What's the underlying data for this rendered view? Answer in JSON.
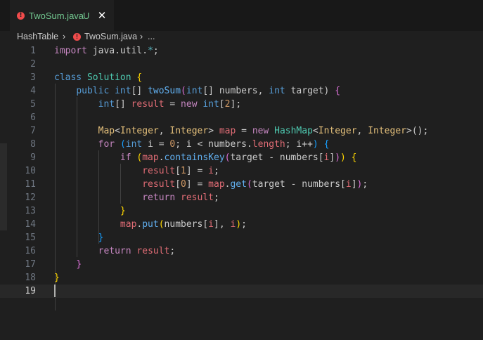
{
  "tab": {
    "filename": "TwoSum.java",
    "status": "U",
    "close_glyph": "✕",
    "error_glyph": "!"
  },
  "breadcrumb": {
    "folder": "HashTable",
    "sep": "›",
    "file": "TwoSum.java",
    "more": "..."
  },
  "editor": {
    "current_line": 19,
    "lines": [
      {
        "n": "1"
      },
      {
        "n": "2"
      },
      {
        "n": "3"
      },
      {
        "n": "4"
      },
      {
        "n": "5"
      },
      {
        "n": "6"
      },
      {
        "n": "7"
      },
      {
        "n": "8"
      },
      {
        "n": "9"
      },
      {
        "n": "10"
      },
      {
        "n": "11"
      },
      {
        "n": "12"
      },
      {
        "n": "13"
      },
      {
        "n": "14"
      },
      {
        "n": "15"
      },
      {
        "n": "16"
      },
      {
        "n": "17"
      },
      {
        "n": "18"
      },
      {
        "n": "19"
      }
    ]
  },
  "code": {
    "l1": [
      "import",
      " java.util.",
      "*",
      ";"
    ],
    "l3": [
      "class",
      " ",
      "Solution",
      " ",
      "{"
    ],
    "l4": [
      "    ",
      "public",
      " ",
      "int",
      "[] ",
      "twoSum",
      "(",
      "int",
      "[] numbers, ",
      "int",
      " target) ",
      "{"
    ],
    "l5": [
      "        ",
      "int",
      "[] ",
      "result",
      " = ",
      "new",
      " ",
      "int",
      "[",
      "2",
      "];"
    ],
    "l7": [
      "        ",
      "Map",
      "<",
      "Integer",
      ", ",
      "Integer",
      "> ",
      "map",
      " = ",
      "new",
      " ",
      "HashMap",
      "<",
      "Integer",
      ", ",
      "Integer",
      ">",
      "()",
      ";"
    ],
    "l8": [
      "        ",
      "for",
      " ",
      "(",
      "int",
      " i = ",
      "0",
      "; i < numbers.",
      "length",
      "; i++",
      ")",
      " ",
      "{"
    ],
    "l9": [
      "            ",
      "if",
      " ",
      "(",
      "map",
      ".",
      "containsKey",
      "(",
      "target - numbers[",
      "i",
      "]",
      ")",
      ")",
      " ",
      "{"
    ],
    "l10": [
      "                ",
      "result",
      "[",
      "1",
      "] = ",
      "i",
      ";"
    ],
    "l11": [
      "                ",
      "result",
      "[",
      "0",
      "] = ",
      "map",
      ".",
      "get",
      "(",
      "target - numbers[",
      "i",
      "]",
      ")",
      ";"
    ],
    "l12": [
      "                ",
      "return",
      " ",
      "result",
      ";"
    ],
    "l13": [
      "            ",
      "}"
    ],
    "l14": [
      "            ",
      "map",
      ".",
      "put",
      "(",
      "numbers[",
      "i",
      "], ",
      "i",
      ")",
      ";"
    ],
    "l15": [
      "        ",
      "}"
    ],
    "l16": [
      "        ",
      "return",
      " ",
      "result",
      ";"
    ],
    "l17": [
      "    ",
      "}"
    ],
    "l18": [
      "",
      "}"
    ]
  }
}
